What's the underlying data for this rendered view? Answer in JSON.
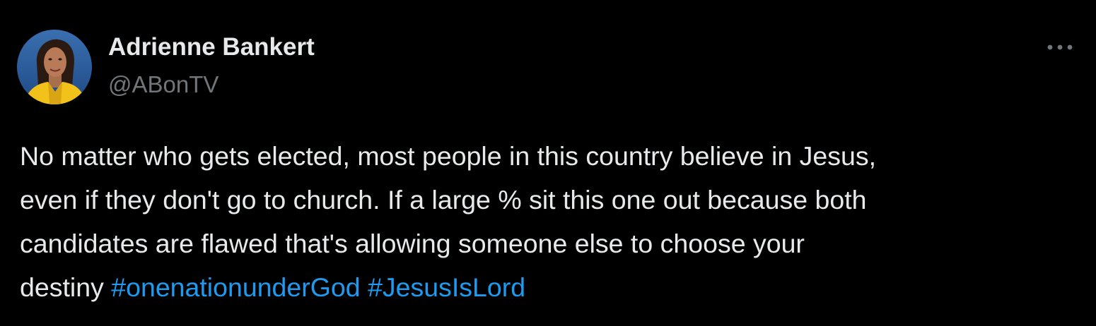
{
  "author": {
    "display_name": "Adrienne Bankert",
    "handle": "@ABonTV",
    "avatar_icon": "profile-photo-avatar"
  },
  "more_icon": "more-horizontal-icon",
  "tweet": {
    "lines": [
      "No matter who gets elected, most people in this country believe in Jesus,",
      "even if they don't go to church. If a large % sit this one out because both",
      "candidates are flawed that's allowing someone else to choose your",
      "destiny"
    ],
    "hashtags": [
      "#onenationunderGod",
      "#JesusIsLord"
    ]
  },
  "colors": {
    "background": "#000000",
    "text": "#e7e9ea",
    "secondary_text": "#71767b",
    "link": "#1d9bf0"
  }
}
